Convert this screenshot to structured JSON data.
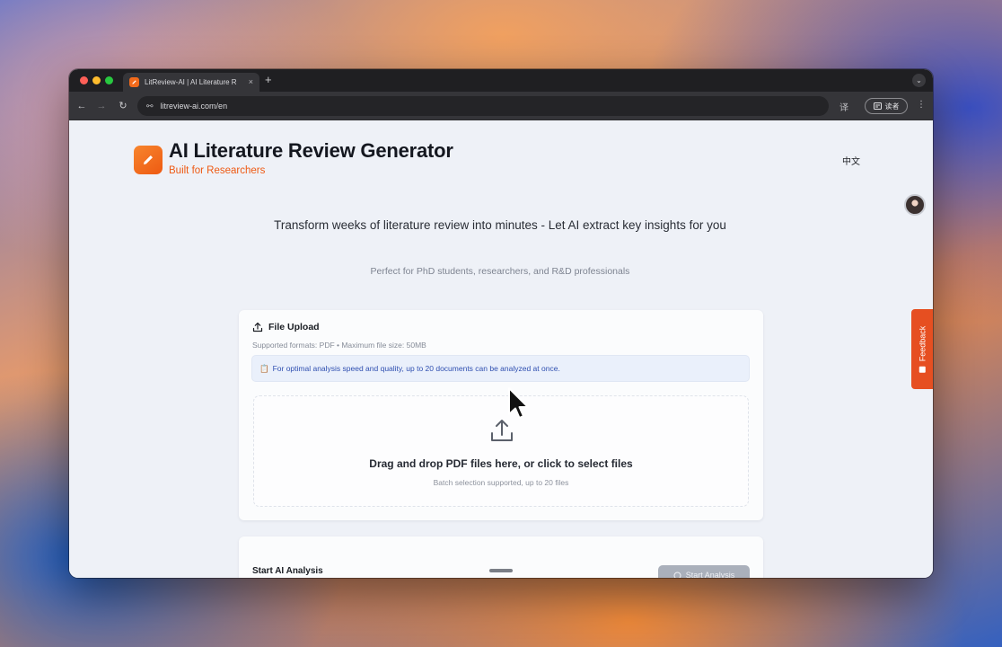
{
  "browser": {
    "tab_title": "LitReview-AI | AI Literature R",
    "tab_close": "×",
    "new_tab": "+",
    "url": "litreview-ai.com/en",
    "reader_label": "读者",
    "controls": {
      "back": "←",
      "forward": "→",
      "reload": "↻",
      "menu_dots": "⋮",
      "tab_menu": "⌄",
      "tune": "⚯",
      "translate": "译"
    }
  },
  "header": {
    "title": "AI Literature Review Generator",
    "subtitle": "Built for Researchers",
    "language_toggle": "中文"
  },
  "hero": {
    "tagline": "Transform weeks of literature review into minutes - Let AI extract key insights for you",
    "audience": "Perfect for PhD students, researchers, and R&D professionals"
  },
  "upload": {
    "title": "File Upload",
    "formats": "Supported formats: PDF • Maximum file size: 50MB",
    "notice_icon": "📋",
    "notice": "For optimal analysis speed and quality, up to 20 documents can be analyzed at once.",
    "drop_text": "Drag and drop PDF files here, or click to select files",
    "drop_sub": "Batch selection supported, up to 20 files"
  },
  "analysis": {
    "title": "Start AI Analysis",
    "button": "Start Analysis"
  },
  "feedback": {
    "label": "Feedback"
  },
  "colors": {
    "accent": "#ee5a14",
    "notice_text": "#2f4fb0",
    "feedback_bg": "#e64f21"
  }
}
